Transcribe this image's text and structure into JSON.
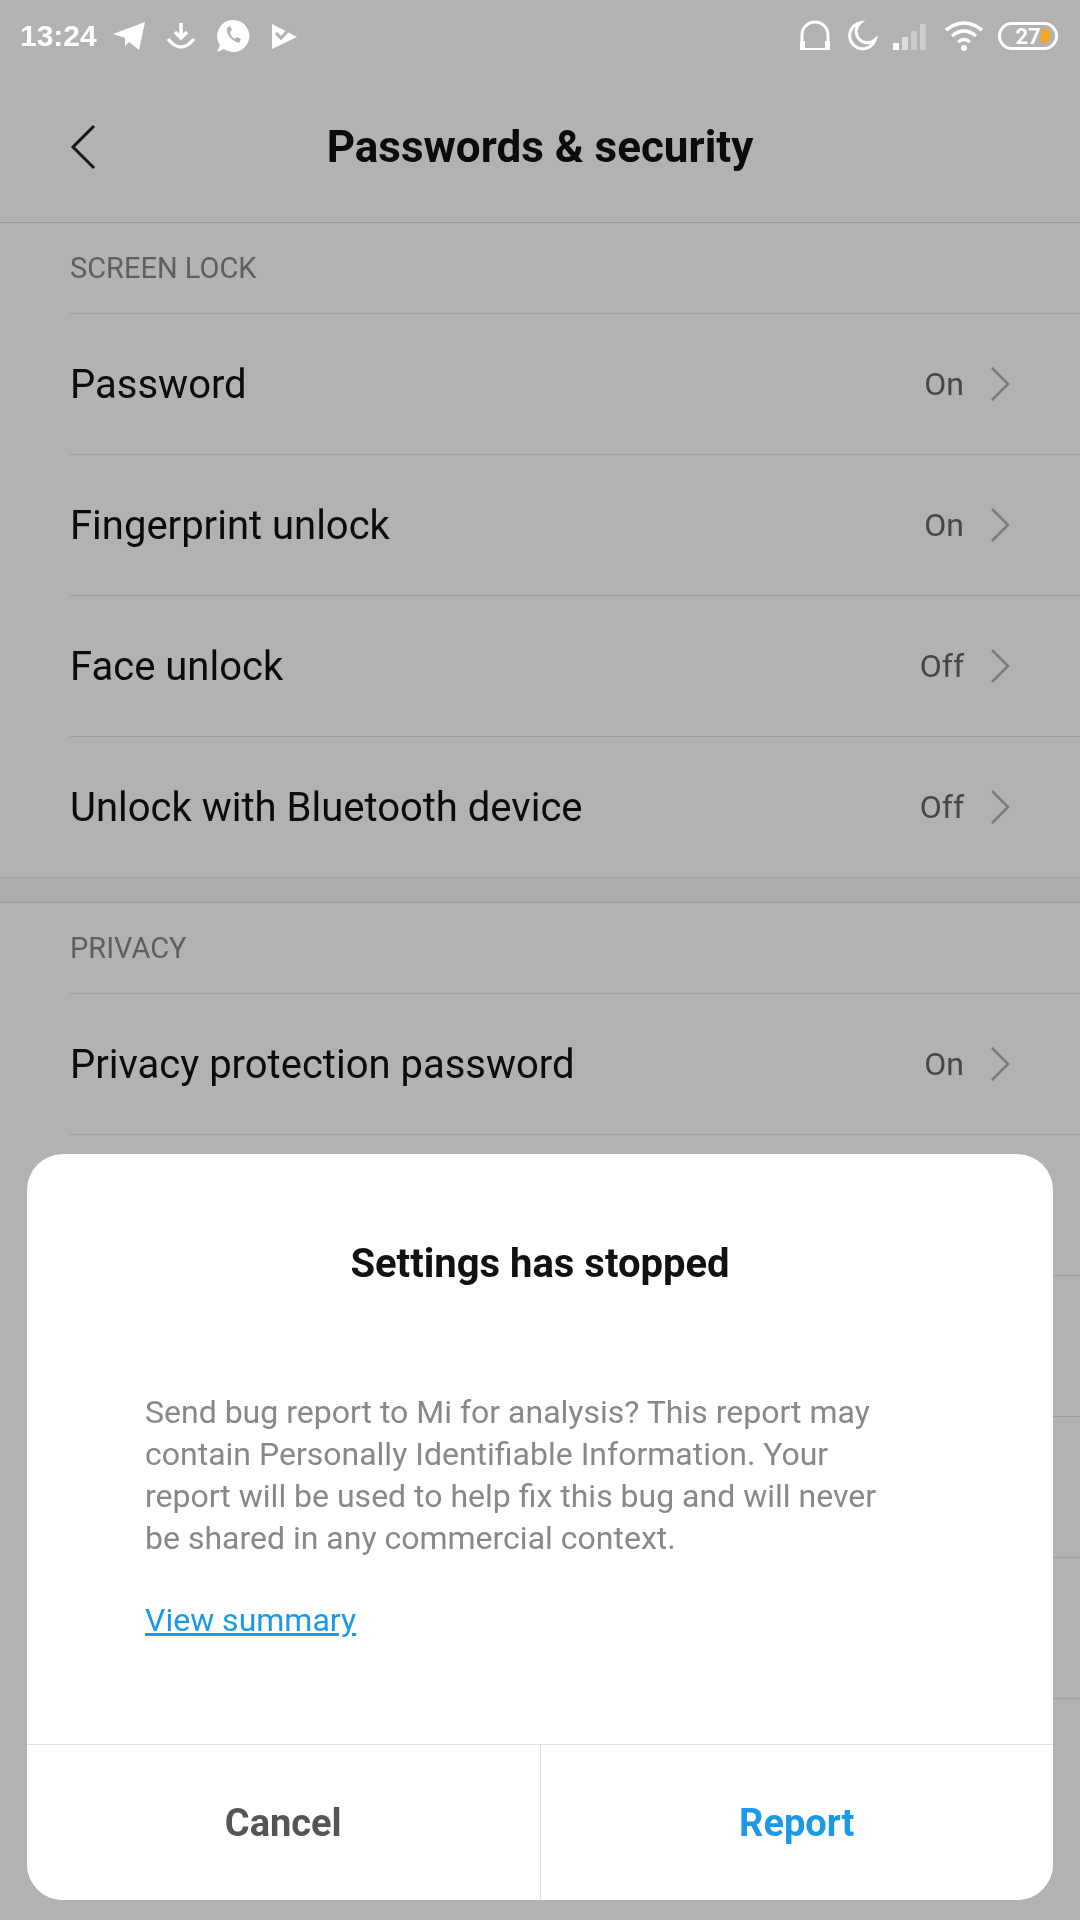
{
  "status_bar": {
    "time": "13:24",
    "battery": "27"
  },
  "header": {
    "title": "Passwords & security"
  },
  "sections": [
    {
      "title": "SCREEN LOCK",
      "items": [
        {
          "label": "Password",
          "value": "On"
        },
        {
          "label": "Fingerprint unlock",
          "value": "On"
        },
        {
          "label": "Face unlock",
          "value": "Off"
        },
        {
          "label": "Unlock with Bluetooth device",
          "value": "Off"
        }
      ]
    },
    {
      "title": "PRIVACY",
      "items": [
        {
          "label": "Privacy protection password",
          "value": "On"
        }
      ]
    }
  ],
  "dialog": {
    "title": "Settings has stopped",
    "message": "Send bug report to Mi for analysis? This report may contain Personally Identifiable Information. Your report will be used to help fix this bug and will never be shared in any commercial context.",
    "link": "View summary",
    "buttons": [
      {
        "label": "Cancel",
        "kind": "secondary"
      },
      {
        "label": "Report",
        "kind": "primary"
      }
    ]
  }
}
